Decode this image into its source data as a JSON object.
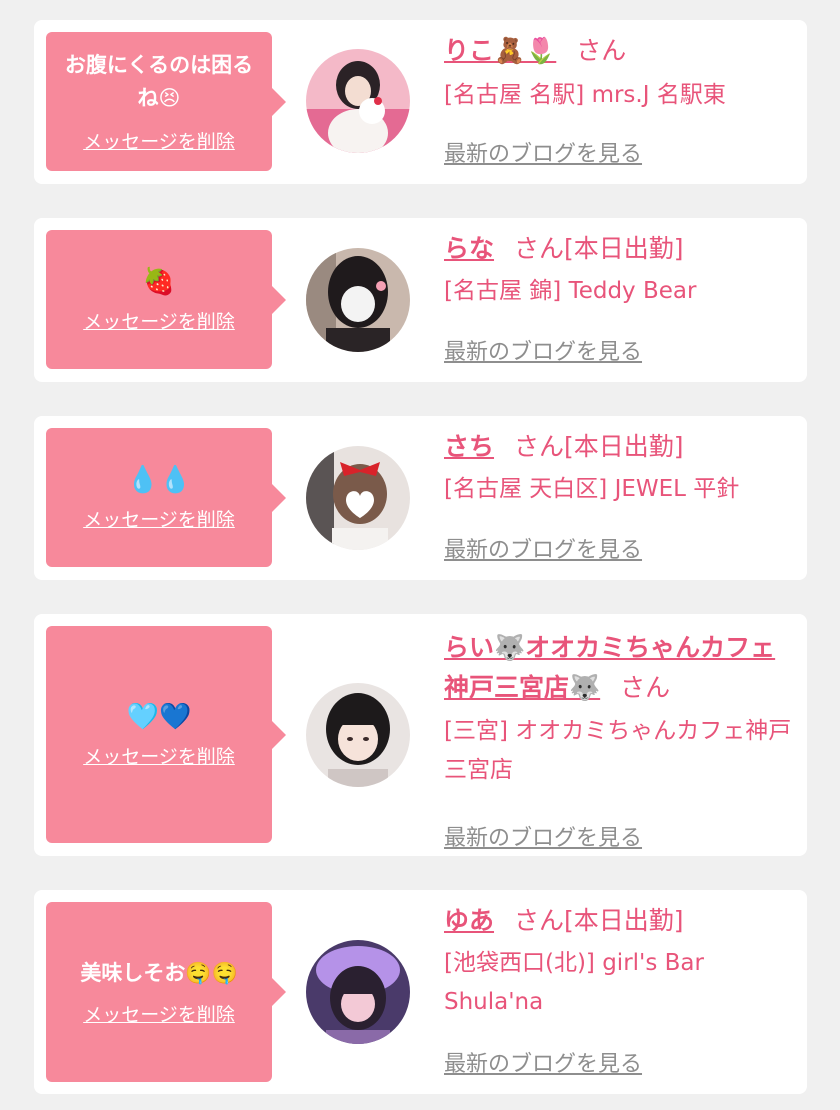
{
  "delete_label": "メッセージを削除",
  "blog_label": "最新のブログを見る",
  "san_label": "さん",
  "cards": [
    {
      "message": "お腹にくるのは困るね😣",
      "name": "りこ🧸🌷",
      "status": "",
      "shop": "[名古屋 名駅] mrs.J 名駅東"
    },
    {
      "message": "🍓",
      "name": "らな",
      "status": "[本日出勤]",
      "shop": "[名古屋 錦] Teddy Bear"
    },
    {
      "message": "💧💧",
      "name": "さち",
      "status": "[本日出勤]",
      "shop": "[名古屋 天白区] JEWEL 平針"
    },
    {
      "message": "🩵💙",
      "name": "らい🐺オオカミちゃんカフェ神戸三宮店🐺",
      "status": "",
      "shop": "[三宮] オオカミちゃんカフェ神戸三宮店"
    },
    {
      "message": "美味しそお🤤🤤",
      "name": "ゆあ",
      "status": "[本日出勤]",
      "shop": "[池袋西口(北)] girl's Bar Shula'na"
    }
  ],
  "colors": {
    "background": "#f0f0f0",
    "bubble": "#f7899b",
    "accent": "#e8547a",
    "link_gray": "#8e8e8e"
  }
}
